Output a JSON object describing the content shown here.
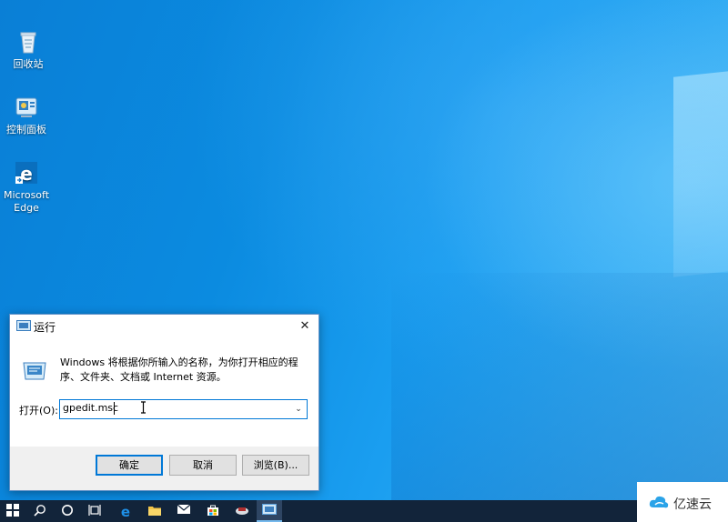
{
  "desktop": {
    "icons": [
      {
        "label": "回收站",
        "icon": "recycle-bin-icon"
      },
      {
        "label": "控制面板",
        "icon": "control-panel-icon"
      },
      {
        "label": "Microsoft",
        "label2": "Edge",
        "icon": "edge-icon"
      }
    ]
  },
  "run_dialog": {
    "title": "运行",
    "close_glyph": "✕",
    "description": "Windows 将根据你所输入的名称，为你打开相应的程序、文件夹、文档或 Internet 资源。",
    "open_label": "打开(O):",
    "input_value": "gpedit.msc",
    "dropdown_glyph": "⌄",
    "buttons": {
      "ok": "确定",
      "cancel": "取消",
      "browse": "浏览(B)..."
    }
  },
  "taskbar": {
    "items": [
      "start-icon",
      "search-icon",
      "cortana-icon",
      "task-view-icon",
      "edge-icon",
      "file-explorer-icon",
      "mail-icon",
      "store-icon",
      "app-icon",
      "run-icon"
    ]
  },
  "watermark": {
    "text": "亿速云"
  },
  "colors": {
    "accent": "#0078d7",
    "taskbar": "#12243a",
    "desktop": "#0b8be0"
  }
}
